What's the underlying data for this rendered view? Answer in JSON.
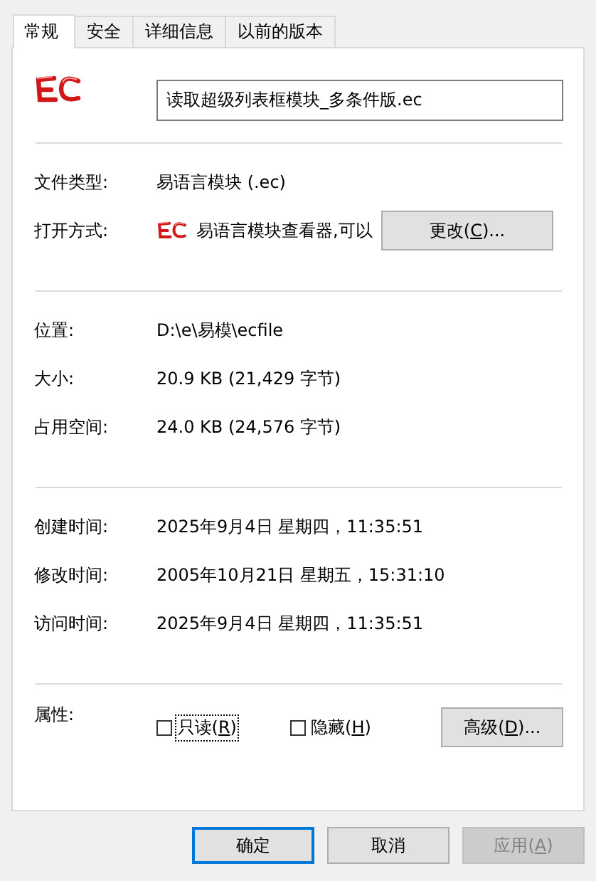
{
  "tabs": [
    {
      "label": "常规",
      "selected": true
    },
    {
      "label": "安全",
      "selected": false
    },
    {
      "label": "详细信息",
      "selected": false
    },
    {
      "label": "以前的版本",
      "selected": false
    }
  ],
  "file_name": "读取超级列表框模块_多条件版.ec",
  "sections": [
    {
      "rows": [
        {
          "label": "文件类型:",
          "value": "易语言模块 (.ec)"
        },
        {
          "label": "打开方式:",
          "value": "易语言模块查看器,可以",
          "kind": "app",
          "button": [
            "更改(",
            "C",
            ")..."
          ]
        }
      ]
    },
    {
      "rows": [
        {
          "label": "位置:",
          "value": "D:\\e\\易模\\ecfile"
        },
        {
          "label": "大小:",
          "value": "20.9 KB (21,429 字节)"
        },
        {
          "label": "占用空间:",
          "value": "24.0 KB (24,576 字节)"
        }
      ]
    },
    {
      "rows": [
        {
          "label": "创建时间:",
          "value": "2025年9月4日 星期四，11:35:51"
        },
        {
          "label": "修改时间:",
          "value": "2005年10月21日 星期五，15:31:10"
        },
        {
          "label": "访问时间:",
          "value": "2025年9月4日 星期四，11:35:51"
        }
      ]
    }
  ],
  "attributes": {
    "label": "属性:",
    "checkboxes": [
      {
        "label": [
          "只读(",
          "R",
          ")"
        ],
        "checked": false,
        "focused": true
      },
      {
        "label": [
          "隐藏(",
          "H",
          ")"
        ],
        "checked": false,
        "focused": false
      }
    ],
    "button": [
      "高级(",
      "D",
      ")..."
    ]
  },
  "buttons": [
    {
      "label": [
        "确定"
      ],
      "default": true,
      "disabled": false
    },
    {
      "label": [
        "取消"
      ],
      "default": false,
      "disabled": false
    },
    {
      "label": [
        "应用(",
        "A",
        ")"
      ],
      "default": false,
      "disabled": true
    }
  ]
}
